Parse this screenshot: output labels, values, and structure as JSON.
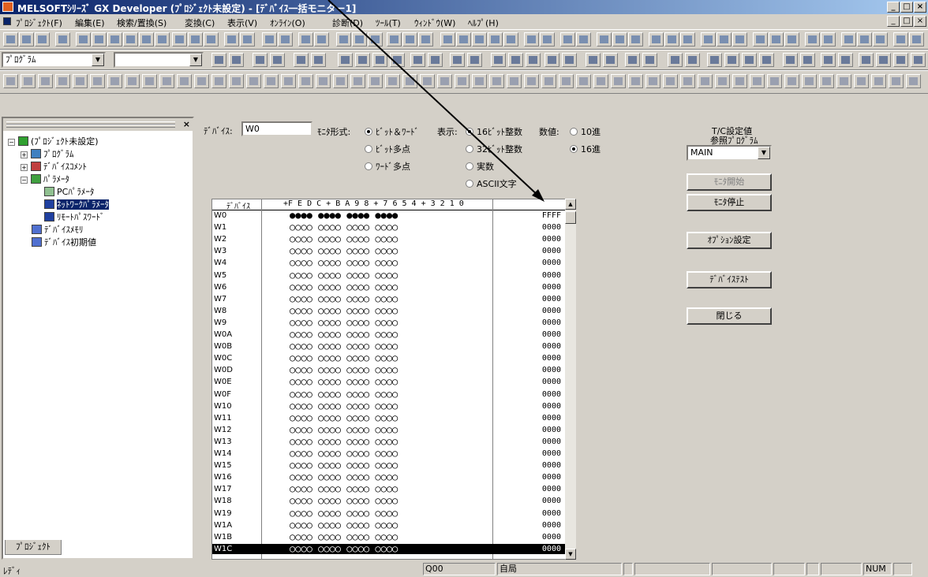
{
  "window": {
    "title": "MELSOFTｼﾘｰｽﾞ GX Developer (ﾌﾟﾛｼﾞｪｸﾄ未設定) - [ﾃﾞﾊﾞｲｽ一括モニター1]",
    "min": "_",
    "max": "□",
    "close": "×"
  },
  "menu": [
    {
      "label": "ﾌﾟﾛｼﾞｪｸﾄ(F)"
    },
    {
      "label": "編集(E)"
    },
    {
      "label": "検索/置換(S)"
    },
    {
      "label": "変換(C)"
    },
    {
      "label": "表示(V)"
    },
    {
      "label": "ｵﾝﾗｲﾝ(O)"
    },
    {
      "label": "診断(D)"
    },
    {
      "label": "ﾂｰﾙ(T)"
    },
    {
      "label": "ｳｨﾝﾄﾞｳ(W)"
    },
    {
      "label": "ﾍﾙﾌﾟ(H)"
    }
  ],
  "toolbar": {
    "program_combo": "ﾌﾟﾛｸﾞﾗﾑ",
    "second_combo": ""
  },
  "tree": {
    "root": "(ﾌﾟﾛｼﾞｪｸﾄ未設定)",
    "items": [
      {
        "label": "ﾌﾟﾛｸﾞﾗﾑ"
      },
      {
        "label": "ﾃﾞﾊﾞｲｽｺﾒﾝﾄ"
      },
      {
        "label": "ﾊﾟﾗﾒｰﾀ"
      },
      {
        "label": "PCﾊﾟﾗﾒｰﾀ"
      },
      {
        "label": "ﾈｯﾄﾜｰｸﾊﾟﾗﾒｰﾀ"
      },
      {
        "label": "ﾘﾓｰﾄﾊﾟｽﾜｰﾄﾞ"
      },
      {
        "label": "ﾃﾞﾊﾞｲｽﾒﾓﾘ"
      },
      {
        "label": "ﾃﾞﾊﾞｲｽ初期値"
      }
    ],
    "tab": "ﾌﾟﾛｼﾞｪｸﾄ"
  },
  "monitor": {
    "device_label": "ﾃﾞﾊﾞｲｽ:",
    "device_value": "W0",
    "format_label": "ﾓﾆﾀ形式:",
    "format_options": [
      "ﾋﾞｯﾄ＆ﾜｰﾄﾞ",
      "ﾋﾞｯﾄ多点",
      "ﾜｰﾄﾞ多点"
    ],
    "display_label": "表示:",
    "display_options": [
      "16ﾋﾞｯﾄ整数",
      "32ﾋﾞｯﾄ整数",
      "実数",
      "ASCII文字"
    ],
    "value_label": "数値:",
    "value_options": [
      "10進",
      "16進"
    ],
    "tc_label1": "T/C設定値",
    "tc_label2": "参照ﾌﾟﾛｸﾞﾗﾑ",
    "tc_program": "MAIN",
    "btn_start": "ﾓﾆﾀ開始",
    "btn_stop": "ﾓﾆﾀ停止",
    "btn_option": "ｵﾌﾟｼｮﾝ設定",
    "btn_test": "ﾃﾞﾊﾞｲｽﾃｽﾄ",
    "btn_close": "閉じる"
  },
  "grid": {
    "col_device": "ﾃﾞﾊﾞｲｽ",
    "col_bits": "+F E D C  + B A 9 8  + 7 6 5 4  + 3 2 1 0",
    "rows": [
      {
        "dev": "W0",
        "bits": "●●●● ●●●● ●●●● ●●●●",
        "val": "FFFF"
      },
      {
        "dev": "W1",
        "bits": "○○○○ ○○○○ ○○○○ ○○○○",
        "val": "0000"
      },
      {
        "dev": "W2",
        "bits": "○○○○ ○○○○ ○○○○ ○○○○",
        "val": "0000"
      },
      {
        "dev": "W3",
        "bits": "○○○○ ○○○○ ○○○○ ○○○○",
        "val": "0000"
      },
      {
        "dev": "W4",
        "bits": "○○○○ ○○○○ ○○○○ ○○○○",
        "val": "0000"
      },
      {
        "dev": "W5",
        "bits": "○○○○ ○○○○ ○○○○ ○○○○",
        "val": "0000"
      },
      {
        "dev": "W6",
        "bits": "○○○○ ○○○○ ○○○○ ○○○○",
        "val": "0000"
      },
      {
        "dev": "W7",
        "bits": "○○○○ ○○○○ ○○○○ ○○○○",
        "val": "0000"
      },
      {
        "dev": "W8",
        "bits": "○○○○ ○○○○ ○○○○ ○○○○",
        "val": "0000"
      },
      {
        "dev": "W9",
        "bits": "○○○○ ○○○○ ○○○○ ○○○○",
        "val": "0000"
      },
      {
        "dev": "W0A",
        "bits": "○○○○ ○○○○ ○○○○ ○○○○",
        "val": "0000"
      },
      {
        "dev": "W0B",
        "bits": "○○○○ ○○○○ ○○○○ ○○○○",
        "val": "0000"
      },
      {
        "dev": "W0C",
        "bits": "○○○○ ○○○○ ○○○○ ○○○○",
        "val": "0000"
      },
      {
        "dev": "W0D",
        "bits": "○○○○ ○○○○ ○○○○ ○○○○",
        "val": "0000"
      },
      {
        "dev": "W0E",
        "bits": "○○○○ ○○○○ ○○○○ ○○○○",
        "val": "0000"
      },
      {
        "dev": "W0F",
        "bits": "○○○○ ○○○○ ○○○○ ○○○○",
        "val": "0000"
      },
      {
        "dev": "W10",
        "bits": "○○○○ ○○○○ ○○○○ ○○○○",
        "val": "0000"
      },
      {
        "dev": "W11",
        "bits": "○○○○ ○○○○ ○○○○ ○○○○",
        "val": "0000"
      },
      {
        "dev": "W12",
        "bits": "○○○○ ○○○○ ○○○○ ○○○○",
        "val": "0000"
      },
      {
        "dev": "W13",
        "bits": "○○○○ ○○○○ ○○○○ ○○○○",
        "val": "0000"
      },
      {
        "dev": "W14",
        "bits": "○○○○ ○○○○ ○○○○ ○○○○",
        "val": "0000"
      },
      {
        "dev": "W15",
        "bits": "○○○○ ○○○○ ○○○○ ○○○○",
        "val": "0000"
      },
      {
        "dev": "W16",
        "bits": "○○○○ ○○○○ ○○○○ ○○○○",
        "val": "0000"
      },
      {
        "dev": "W17",
        "bits": "○○○○ ○○○○ ○○○○ ○○○○",
        "val": "0000"
      },
      {
        "dev": "W18",
        "bits": "○○○○ ○○○○ ○○○○ ○○○○",
        "val": "0000"
      },
      {
        "dev": "W19",
        "bits": "○○○○ ○○○○ ○○○○ ○○○○",
        "val": "0000"
      },
      {
        "dev": "W1A",
        "bits": "○○○○ ○○○○ ○○○○ ○○○○",
        "val": "0000"
      },
      {
        "dev": "W1B",
        "bits": "○○○○ ○○○○ ○○○○ ○○○○",
        "val": "0000"
      },
      {
        "dev": "W1C",
        "bits": "○○○○ ○○○○ ○○○○ ○○○○",
        "val": "0000"
      }
    ]
  },
  "status": {
    "ready": "ﾚﾃﾞｨ",
    "cpu": "Q00",
    "station": "自局",
    "num": "NUM"
  }
}
